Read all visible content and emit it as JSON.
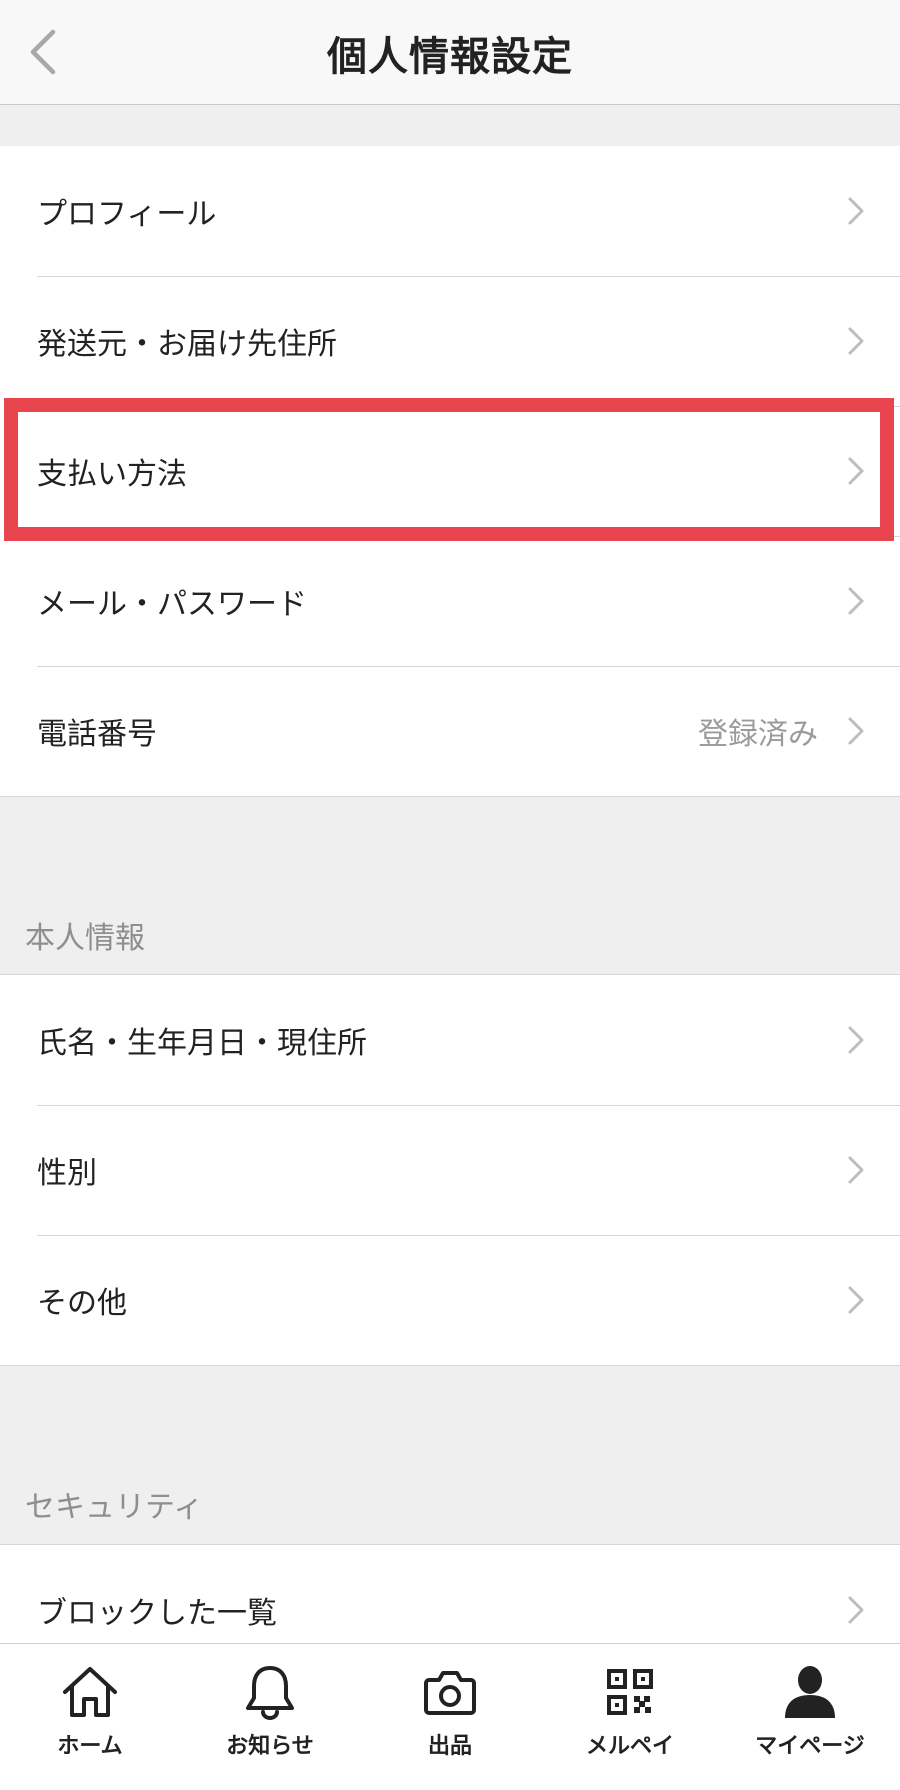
{
  "header": {
    "title": "個人情報設定",
    "back_icon": "chevron-left-icon"
  },
  "account_settings": {
    "items": [
      {
        "label": "プロフィール",
        "value": ""
      },
      {
        "label": "発送元・お届け先住所",
        "value": ""
      },
      {
        "label": "支払い方法",
        "value": ""
      },
      {
        "label": "メール・パスワード",
        "value": ""
      },
      {
        "label": "電話番号",
        "value": "登録済み"
      }
    ]
  },
  "personal_info": {
    "heading": "本人情報",
    "items": [
      {
        "label": "氏名・生年月日・現住所"
      },
      {
        "label": "性別"
      },
      {
        "label": "その他"
      }
    ]
  },
  "security": {
    "heading": "セキュリティ",
    "items": [
      {
        "label": "ブロックした一覧"
      }
    ]
  },
  "highlight": {
    "color": "#e8454f",
    "target": "支払い方法"
  },
  "tabbar": {
    "tabs": [
      {
        "label": "ホーム",
        "icon": "home-icon"
      },
      {
        "label": "お知らせ",
        "icon": "bell-icon"
      },
      {
        "label": "出品",
        "icon": "camera-icon"
      },
      {
        "label": "メルペイ",
        "icon": "qr-code-icon"
      },
      {
        "label": "マイページ",
        "icon": "person-icon"
      }
    ]
  }
}
